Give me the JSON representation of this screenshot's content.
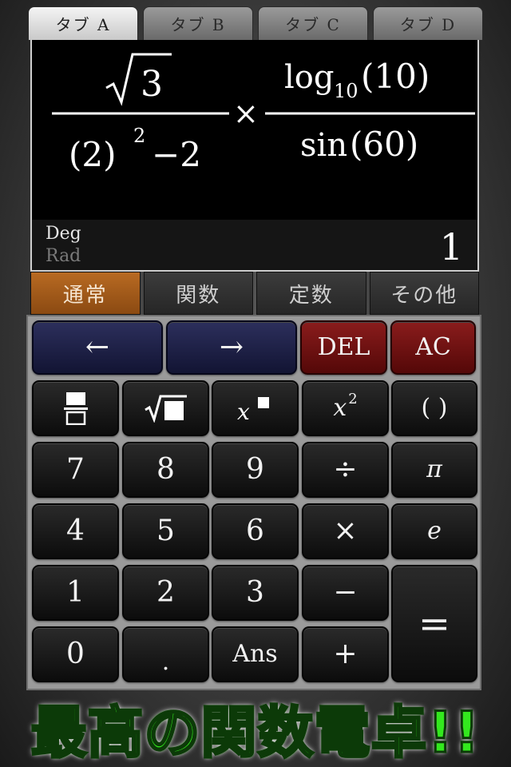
{
  "tabs": [
    "タブ A",
    "タブ B",
    "タブ C",
    "タブ D"
  ],
  "display": {
    "numerator_left": "3",
    "denominator_left_base": "(2)",
    "denominator_left_exp": "2",
    "denominator_left_rest": "−2",
    "times": "×",
    "log_base_text": "log",
    "log_sub": "10",
    "log_arg": "(10)",
    "sin_text": "sin",
    "sin_arg": "(60)",
    "mode_deg": "Deg",
    "mode_rad": "Rad",
    "result": "1"
  },
  "mode_tabs": [
    "通常",
    "関数",
    "定数",
    "その他"
  ],
  "keys": {
    "left": "←",
    "right": "→",
    "del": "DEL",
    "ac": "AC",
    "x_sq": "x",
    "x_sq_exp": "2",
    "paren": "( )",
    "k7": "7",
    "k8": "8",
    "k9": "9",
    "divide": "÷",
    "pi": "π",
    "k4": "4",
    "k5": "5",
    "k6": "6",
    "multiply": "×",
    "e": "e",
    "k1": "1",
    "k2": "2",
    "k3": "3",
    "minus": "−",
    "equals": "=",
    "k0": "0",
    "dot": ".",
    "ans": "Ans",
    "plus": "+"
  },
  "banner": "最高の関数電卓!!"
}
